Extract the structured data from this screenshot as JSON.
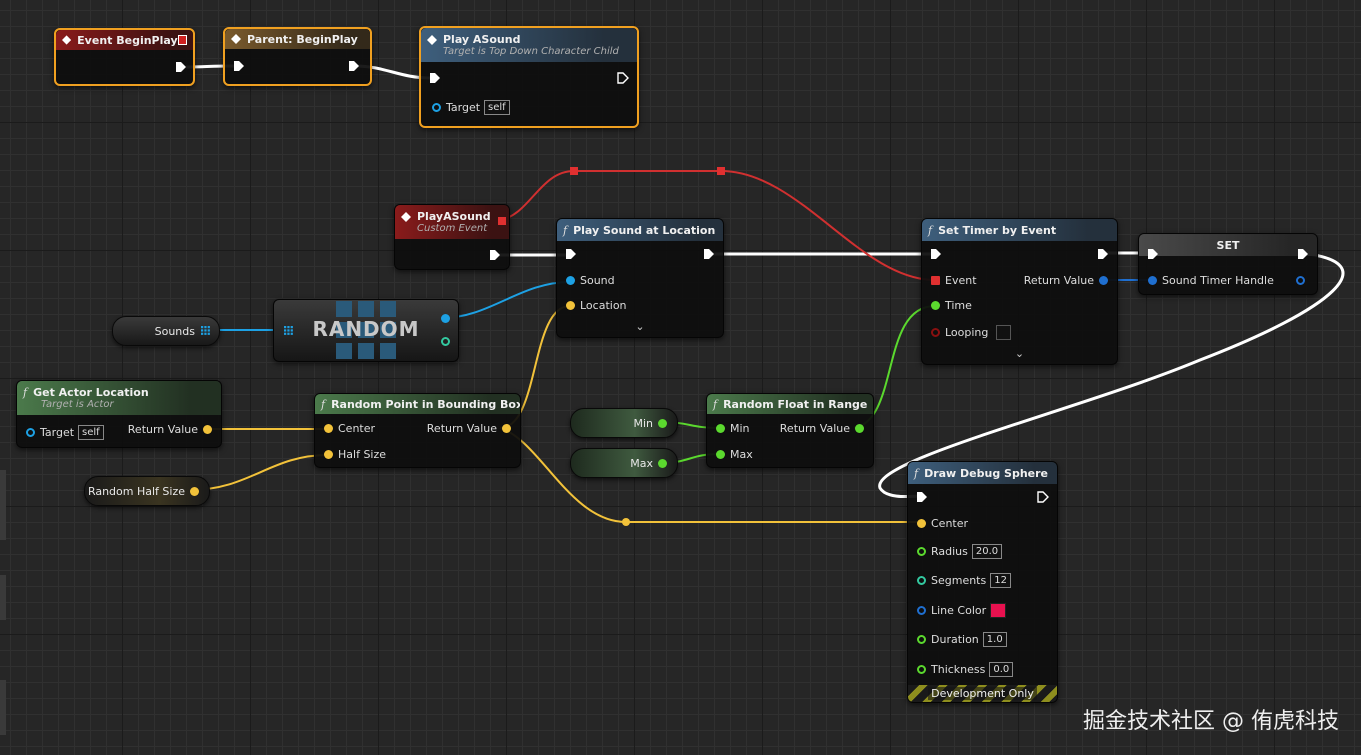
{
  "nodes": {
    "event_beginplay": {
      "title": "Event BeginPlay"
    },
    "parent_beginplay": {
      "title": "Parent: BeginPlay"
    },
    "play_asound_call": {
      "title": "Play ASound",
      "subtitle": "Target is Top Down Character Child",
      "target_label": "Target",
      "target_value": "self"
    },
    "playasound_event": {
      "title": "PlayASound",
      "subtitle": "Custom Event"
    },
    "play_sound_at_location": {
      "title": "Play Sound at Location",
      "sound_label": "Sound",
      "location_label": "Location"
    },
    "set_timer_by_event": {
      "title": "Set Timer by Event",
      "event_label": "Event",
      "return_label": "Return Value",
      "time_label": "Time",
      "looping_label": "Looping"
    },
    "set_node": {
      "title": "SET",
      "handle_label": "Sound Timer Handle"
    },
    "sounds_var": {
      "label": "Sounds"
    },
    "random_node": {
      "title": "RANDOM"
    },
    "get_actor_location": {
      "title": "Get Actor Location",
      "subtitle": "Target is Actor",
      "target_label": "Target",
      "target_value": "self",
      "return_label": "Return Value"
    },
    "random_point_bbox": {
      "title": "Random Point in Bounding Box",
      "center_label": "Center",
      "halfsize_label": "Half Size",
      "return_label": "Return Value"
    },
    "random_half_size_var": {
      "label": "Random Half Size"
    },
    "min_var": {
      "label": "Min"
    },
    "max_var": {
      "label": "Max"
    },
    "random_float_in_range": {
      "title": "Random Float in Range",
      "min_label": "Min",
      "max_label": "Max",
      "return_label": "Return Value"
    },
    "draw_debug_sphere": {
      "title": "Draw Debug Sphere",
      "center_label": "Center",
      "radius_label": "Radius",
      "radius_value": "20.0",
      "segments_label": "Segments",
      "segments_value": "12",
      "linecolor_label": "Line Color",
      "linecolor_value": "#e8114f",
      "duration_label": "Duration",
      "duration_value": "1.0",
      "thickness_label": "Thickness",
      "thickness_value": "0.0",
      "footer": "Development Only"
    }
  },
  "watermark": "掘金技术社区 @ 侑虎科技",
  "colors": {
    "exec": "#ffffff",
    "vector": "#f2c23a",
    "object": "#1da1e4",
    "float": "#5bd92e",
    "delegate": "#e03030",
    "struct": "#1f6fd0",
    "selection": "#f0a020"
  },
  "icons": {
    "function": "function-f-icon",
    "event": "event-diamond-icon",
    "exec": "exec-arrow-icon",
    "expand": "chevron-down-icon",
    "array": "array-grid-icon"
  }
}
